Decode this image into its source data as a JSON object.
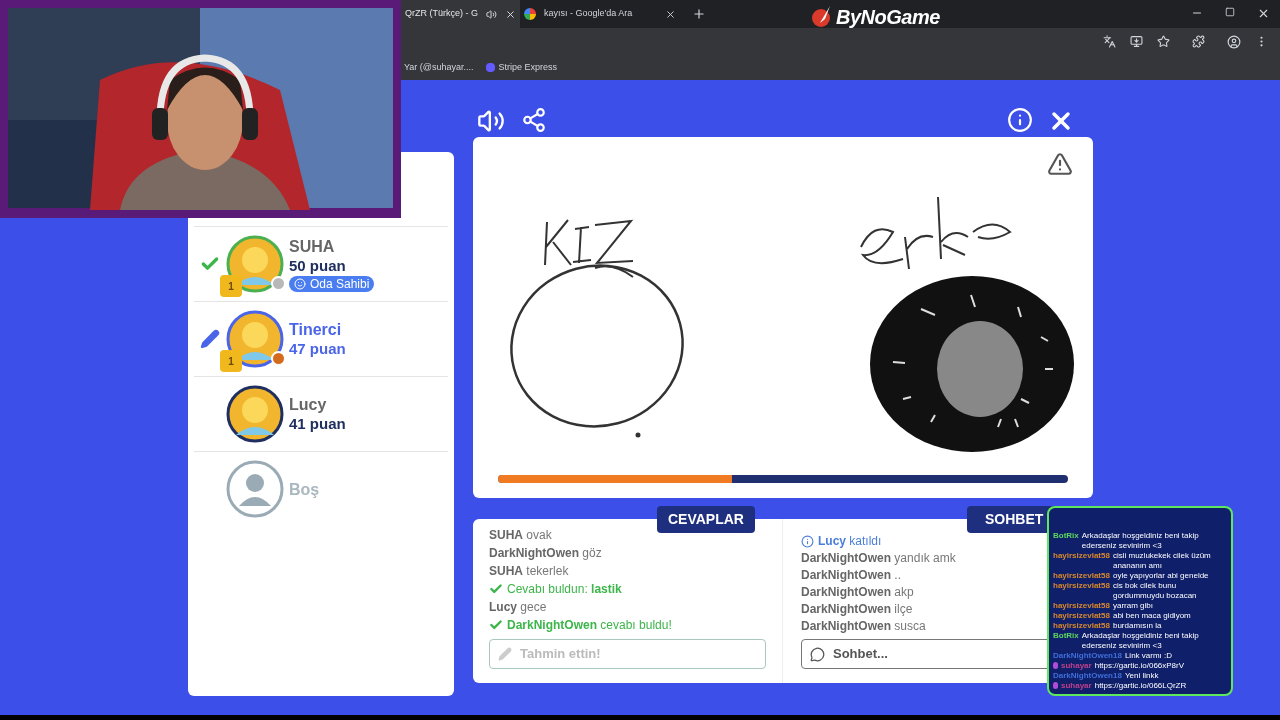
{
  "browser": {
    "tabs": [
      {
        "title": "QrZR (Türkçe) - G",
        "selected": true
      },
      {
        "title": "kayısı - Google'da Ara",
        "selected": false
      }
    ],
    "logo": "ByNoGame",
    "bookmarks": [
      "Yar (@suhayar....",
      "Stripe Express"
    ]
  },
  "players": [
    {
      "name": "SUHA",
      "score": "50 puan",
      "kind": "guessed",
      "trophy": "1",
      "color": "#b8b8b8",
      "badge": "Oda Sahibi"
    },
    {
      "name": "Tinerci",
      "score": "47 puan",
      "kind": "drawing",
      "trophy": "1",
      "color": "#d46a1c"
    },
    {
      "name": "Lucy",
      "score": "41 puan",
      "kind": "none"
    },
    {
      "name": "Boş",
      "kind": "empty"
    }
  ],
  "canvas": {
    "level": 0.41
  },
  "answers": {
    "title": "CEVAPLAR",
    "placeholder": "Tahmin ettin!",
    "messages": [
      {
        "kind": "guess",
        "name": "SUHA",
        "text": "ovak"
      },
      {
        "kind": "guess",
        "name": "DarkNightOwen",
        "text": "göz"
      },
      {
        "kind": "guess",
        "name": "SUHA",
        "text": "tekerlek"
      },
      {
        "kind": "correct",
        "text": "Cevabı buldun: **lastik**"
      },
      {
        "kind": "guess",
        "name": "Lucy",
        "text": "gece"
      },
      {
        "kind": "correct",
        "text": "**DarkNightOwen** cevabı buldu!"
      }
    ]
  },
  "chat": {
    "title": "SOHBET",
    "placeholder": "Sohbet...",
    "messages": [
      {
        "kind": "system",
        "name": "Lucy",
        "text": "katıldı"
      },
      {
        "kind": "message",
        "name": "DarkNightOwen",
        "text": "yandık amk"
      },
      {
        "kind": "message",
        "name": "DarkNightOwen",
        "text": ".."
      },
      {
        "kind": "message",
        "name": "DarkNightOwen",
        "text": "akp"
      },
      {
        "kind": "message",
        "name": "DarkNightOwen",
        "text": "ilçe"
      },
      {
        "kind": "message",
        "name": "DarkNightOwen",
        "text": "susca"
      }
    ]
  },
  "stream_chat": [
    {
      "name": "BotRix",
      "color": "#5cd65c",
      "text": "Arkadaşlar hoşgeldiniz beni takip ederseniz sevinirim <3"
    },
    {
      "name": "hayirsizevlat58",
      "color": "#d9882b",
      "text": "cisli muzlukekek cilek üzüm anananın amı"
    },
    {
      "name": "hayirsizevlat58",
      "color": "#d9882b",
      "text": "oyle yapıyorlar abi genelde"
    },
    {
      "name": "hayirsizevlat58",
      "color": "#d9882b",
      "text": "cis bok cilek bunu gordummuydu bozacan"
    },
    {
      "name": "hayirsizevlat58",
      "color": "#d9882b",
      "text": "yarram gibı"
    },
    {
      "name": "hayirsizevlat58",
      "color": "#d9882b",
      "text": "abi ben maca gidiyom"
    },
    {
      "name": "hayirsizevlat58",
      "color": "#d9882b",
      "text": "burdamısın la"
    },
    {
      "name": "BotRix",
      "color": "#5cd65c",
      "text": "Arkadaşlar hoşgeldiniz beni takip ederseniz sevinirim <3"
    },
    {
      "name": "DarkNightOwen18",
      "color": "#3f6fd8",
      "text": "Link varmı :D"
    },
    {
      "name": "suhayar",
      "color": "#c0408a",
      "badge": true,
      "text": "https://gartic.io/066xP8rV"
    },
    {
      "name": "DarkNightOwen18",
      "color": "#3f6fd8",
      "text": "Yeni linkk"
    },
    {
      "name": "suhayar",
      "color": "#c0408a",
      "badge": true,
      "text": "https://gartic.io/066LQrZR"
    }
  ]
}
